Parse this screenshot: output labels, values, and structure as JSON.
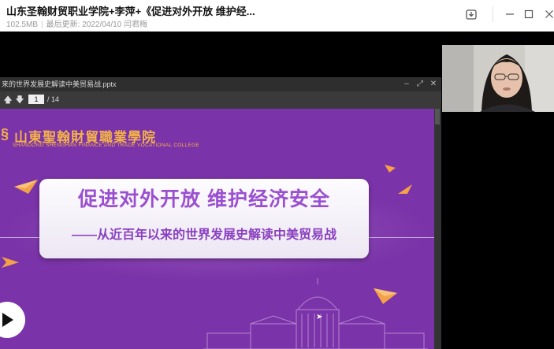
{
  "header": {
    "title": "山东圣翰财贸职业学院+李萍+《促进对外开放 维护经...",
    "file_size": "102.5MB",
    "updated": "最后更新: 2022/04/10 闫君梅"
  },
  "window_controls": [
    "download-icon",
    "minimize-icon",
    "maximize-icon",
    "close-icon"
  ],
  "viewer": {
    "file_name": "来的世界发展史解读中美贸易战.pptx",
    "current_page": "1",
    "total_pages": "/ 14"
  },
  "slide": {
    "logo_cn": "山東聖翰財貿職業學院",
    "logo_en": "SHANDONG SHENGHAN FINANCE AND TRADE VOCATIONAL COLLEGE",
    "main_title": "促进对外开放 维护经济安全",
    "sub_title": "——从近百年以来的世界发展史解读中美贸易战"
  },
  "colors": {
    "slide_bg": "#7a33a8",
    "accent_orange": "#f4a24a",
    "title_purple": "#9a4fd0"
  }
}
